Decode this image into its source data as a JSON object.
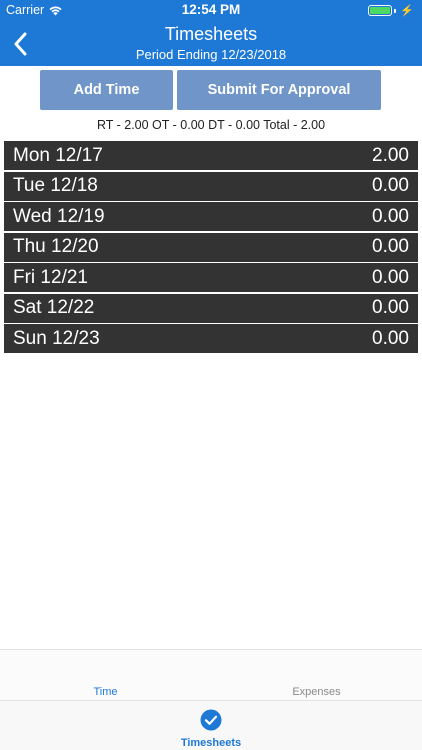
{
  "status_bar": {
    "carrier": "Carrier",
    "time": "12:54 PM",
    "battery_level": 1.0
  },
  "header": {
    "title": "Timesheets",
    "subtitle": "Period Ending 12/23/2018"
  },
  "actions": {
    "add_time_label": "Add Time",
    "submit_label": "Submit For Approval"
  },
  "summary": {
    "text": "RT - 2.00 OT - 0.00 DT - 0.00 Total - 2.00"
  },
  "days": [
    {
      "label": "Mon 12/17",
      "hours": "2.00"
    },
    {
      "label": "Tue 12/18",
      "hours": "0.00"
    },
    {
      "label": "Wed 12/19",
      "hours": "0.00"
    },
    {
      "label": "Thu 12/20",
      "hours": "0.00"
    },
    {
      "label": "Fri 12/21",
      "hours": "0.00"
    },
    {
      "label": "Sat 12/22",
      "hours": "0.00"
    },
    {
      "label": "Sun 12/23",
      "hours": "0.00"
    }
  ],
  "tabs": [
    {
      "label": "Time",
      "active": true
    },
    {
      "label": "Expenses",
      "active": false
    }
  ],
  "tabbar": {
    "label": "Timesheets",
    "icon": "check-circle-icon"
  },
  "colors": {
    "accent": "#1e78d6",
    "button": "#6f95c9",
    "row": "#333333"
  }
}
